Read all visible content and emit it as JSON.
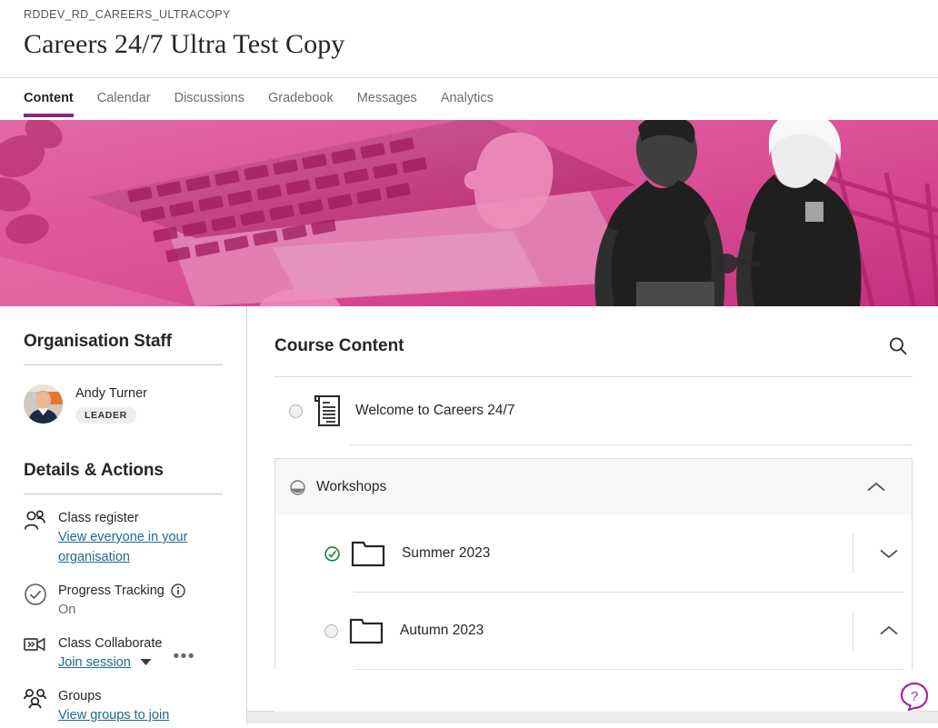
{
  "header": {
    "course_id": "RDDEV_RD_CAREERS_ULTRACOPY",
    "title": "Careers 24/7 Ultra Test Copy"
  },
  "tabs": [
    {
      "label": "Content",
      "active": true
    },
    {
      "label": "Calendar",
      "active": false
    },
    {
      "label": "Discussions",
      "active": false
    },
    {
      "label": "Gradebook",
      "active": false
    },
    {
      "label": "Messages",
      "active": false
    },
    {
      "label": "Analytics",
      "active": false
    }
  ],
  "banner": {
    "alt": "Pink duotone photo of a laptop keyboard and two people talking",
    "accent": "#c2317f",
    "light": "#e05c9e"
  },
  "sidebar": {
    "staff_heading": "Organisation Staff",
    "staff": [
      {
        "name": "Andy Turner",
        "role": "LEADER"
      }
    ],
    "details_heading": "Details & Actions",
    "items": [
      {
        "icon": "class-register-icon",
        "label": "Class register",
        "link": "View everyone in your organisation",
        "sub": "",
        "has_caret": false,
        "has_info": false,
        "has_kebab": false
      },
      {
        "icon": "progress-tracking-icon",
        "label": "Progress Tracking",
        "link": "",
        "sub": "On",
        "has_caret": false,
        "has_info": true,
        "has_kebab": false
      },
      {
        "icon": "class-collaborate-icon",
        "label": "Class Collaborate",
        "link": "Join session",
        "sub": "",
        "has_caret": true,
        "has_info": false,
        "has_kebab": true
      },
      {
        "icon": "groups-icon",
        "label": "Groups",
        "link": "View groups to join",
        "sub": "",
        "has_caret": false,
        "has_info": false,
        "has_kebab": false
      }
    ]
  },
  "content": {
    "title": "Course Content",
    "search_label": "Search course content",
    "items": [
      {
        "type": "document",
        "title": "Welcome to Careers 24/7",
        "progress": "not-started"
      }
    ],
    "sections": [
      {
        "name": "Workshops",
        "progress": "in-progress",
        "expanded": true,
        "chevron": "chevron-up",
        "children": [
          {
            "type": "folder",
            "title": "Summer 2023",
            "progress": "complete",
            "chevron": "chevron-down"
          },
          {
            "type": "folder",
            "title": "Autumn 2023",
            "progress": "not-started",
            "chevron": "chevron-up"
          }
        ]
      }
    ]
  },
  "help": {
    "label": "?",
    "color": "#a429a4"
  },
  "colors": {
    "accent": "#8b248b",
    "link": "#1c6a8e",
    "complete": "#11823b",
    "text": "#262626",
    "muted": "#6d6d6d"
  }
}
